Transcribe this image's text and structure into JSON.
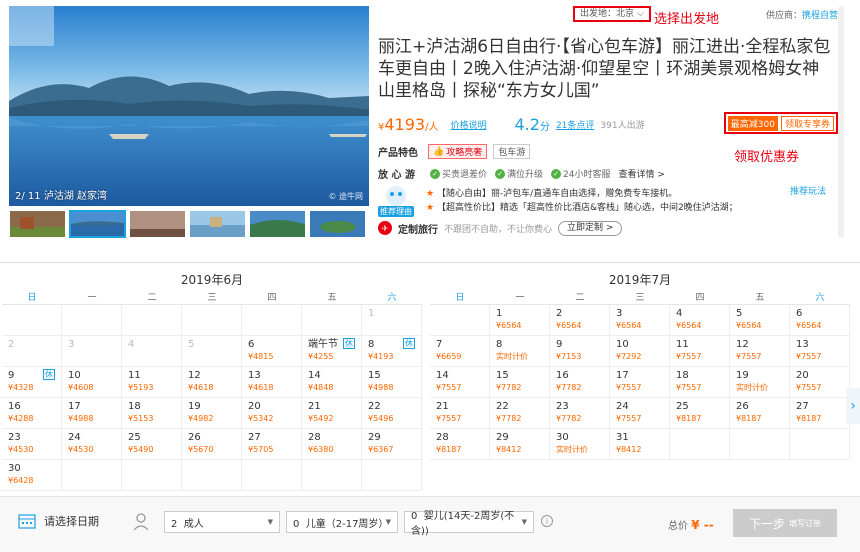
{
  "gallery": {
    "caption": "2/ 11 泸沽湖 赵家湾",
    "watermark": "© 途牛网",
    "thumb_count": 6,
    "active_thumb": 1
  },
  "header": {
    "departure": "出发地：北京",
    "departure_note": "选择出发地",
    "supplier_label": "供应商：",
    "supplier_name": "携程自营",
    "title": "丽江+泸沽湖6日自由行·【省心包车游】丽江进出·全程私家包车更自由丨2晚入住泸沽湖·仰望星空丨环湖美景观格姆女神山里格岛丨探秘“东方女儿国”"
  },
  "price": {
    "symbol": "¥",
    "amount": "4193",
    "unit": "/人",
    "explain": "价格说明",
    "score": "4.2",
    "score_unit": "分",
    "reviews": "21条点评",
    "travelers": "391人出游",
    "coupon_cut": "最高减300",
    "coupon_get": "领取专享券",
    "coupon_note": "领取优惠券"
  },
  "features": {
    "label": "产品特色",
    "tag1": "攻略亮奢",
    "tag2": "包车游",
    "assure_label": "放 心 游",
    "assure1": "买贵退差价",
    "assure2": "满位升级",
    "assure3": "24小时客服",
    "assure_more": "查看详情 >"
  },
  "recommend": {
    "badge": "推荐理由",
    "line1": "【随心自由】丽-泸包车/直通车自由选择，赠免费专车接机。",
    "line2": "【超高性价比】精选「超高性价比酒店&客栈」随心选，中间2晚住泸沽湖；",
    "link": "推荐玩法"
  },
  "custom": {
    "title": "定制旅行",
    "desc": "不跟团不自助，不让你费心",
    "button": "立即定制 >"
  },
  "weekdays": [
    "日",
    "一",
    "二",
    "三",
    "四",
    "五",
    "六"
  ],
  "calendar_june": {
    "title": "2019年6月",
    "cells": [
      {
        "d": ""
      },
      {
        "d": ""
      },
      {
        "d": ""
      },
      {
        "d": ""
      },
      {
        "d": ""
      },
      {
        "d": ""
      },
      {
        "d": "1",
        "dis": true
      },
      {
        "d": "2",
        "dis": true
      },
      {
        "d": "3",
        "dis": true
      },
      {
        "d": "4",
        "dis": true
      },
      {
        "d": "5",
        "dis": true
      },
      {
        "d": "6",
        "p": "¥4815"
      },
      {
        "d": "端午节",
        "p": "¥4255",
        "rest": "休"
      },
      {
        "d": "8",
        "p": "¥4193",
        "rest": "休"
      },
      {
        "d": "9",
        "p": "¥4328",
        "rest": "休"
      },
      {
        "d": "10",
        "p": "¥4608"
      },
      {
        "d": "11",
        "p": "¥5193"
      },
      {
        "d": "12",
        "p": "¥4618"
      },
      {
        "d": "13",
        "p": "¥4618"
      },
      {
        "d": "14",
        "p": "¥4848"
      },
      {
        "d": "15",
        "p": "¥4988"
      },
      {
        "d": "16",
        "p": "¥4288"
      },
      {
        "d": "17",
        "p": "¥4988"
      },
      {
        "d": "18",
        "p": "¥5153"
      },
      {
        "d": "19",
        "p": "¥4982"
      },
      {
        "d": "20",
        "p": "¥5342"
      },
      {
        "d": "21",
        "p": "¥5492"
      },
      {
        "d": "22",
        "p": "¥5496"
      },
      {
        "d": "23",
        "p": "¥4530"
      },
      {
        "d": "24",
        "p": "¥4530"
      },
      {
        "d": "25",
        "p": "¥5490"
      },
      {
        "d": "26",
        "p": "¥5670"
      },
      {
        "d": "27",
        "p": "¥5705"
      },
      {
        "d": "28",
        "p": "¥6380"
      },
      {
        "d": "29",
        "p": "¥6367"
      },
      {
        "d": "30",
        "p": "¥6428"
      },
      {
        "d": ""
      },
      {
        "d": ""
      },
      {
        "d": ""
      },
      {
        "d": ""
      },
      {
        "d": ""
      },
      {
        "d": ""
      }
    ]
  },
  "calendar_july": {
    "title": "2019年7月",
    "cells": [
      {
        "d": ""
      },
      {
        "d": "1",
        "p": "¥6564"
      },
      {
        "d": "2",
        "p": "¥6564"
      },
      {
        "d": "3",
        "p": "¥6564"
      },
      {
        "d": "4",
        "p": "¥6564"
      },
      {
        "d": "5",
        "p": "¥6564"
      },
      {
        "d": "6",
        "p": "¥6564"
      },
      {
        "d": "7",
        "p": "¥6659"
      },
      {
        "d": "8",
        "p": "实时计价"
      },
      {
        "d": "9",
        "p": "¥7153"
      },
      {
        "d": "10",
        "p": "¥7292"
      },
      {
        "d": "11",
        "p": "¥7557"
      },
      {
        "d": "12",
        "p": "¥7557"
      },
      {
        "d": "13",
        "p": "¥7557"
      },
      {
        "d": "14",
        "p": "¥7557"
      },
      {
        "d": "15",
        "p": "¥7782"
      },
      {
        "d": "16",
        "p": "¥7782"
      },
      {
        "d": "17",
        "p": "¥7557"
      },
      {
        "d": "18",
        "p": "¥7557"
      },
      {
        "d": "19",
        "p": "实时计价"
      },
      {
        "d": "20",
        "p": "¥7557"
      },
      {
        "d": "21",
        "p": "¥7557"
      },
      {
        "d": "22",
        "p": "¥7782"
      },
      {
        "d": "23",
        "p": "¥7782"
      },
      {
        "d": "24",
        "p": "¥7557"
      },
      {
        "d": "25",
        "p": "¥8187"
      },
      {
        "d": "26",
        "p": "¥8187"
      },
      {
        "d": "27",
        "p": "¥8187"
      },
      {
        "d": "28",
        "p": "¥8187"
      },
      {
        "d": "29",
        "p": "¥8412"
      },
      {
        "d": "30",
        "p": "实时计价"
      },
      {
        "d": "31",
        "p": "¥8412"
      },
      {
        "d": ""
      },
      {
        "d": ""
      },
      {
        "d": ""
      }
    ]
  },
  "booking": {
    "date_prompt": "请选择日期",
    "adults": "2",
    "adults_label": "成人",
    "children": "0",
    "children_label": "儿童（2-17周岁）",
    "infants": "0",
    "infants_label": "婴儿(14天-2周岁(不含))",
    "total_label": "总价",
    "total_value": "¥ --",
    "next": "下一步",
    "next_sub": "填写订单"
  },
  "colors": {
    "accent": "#1ba0e2",
    "price": "#ff6600",
    "annotation": "#e60012"
  }
}
